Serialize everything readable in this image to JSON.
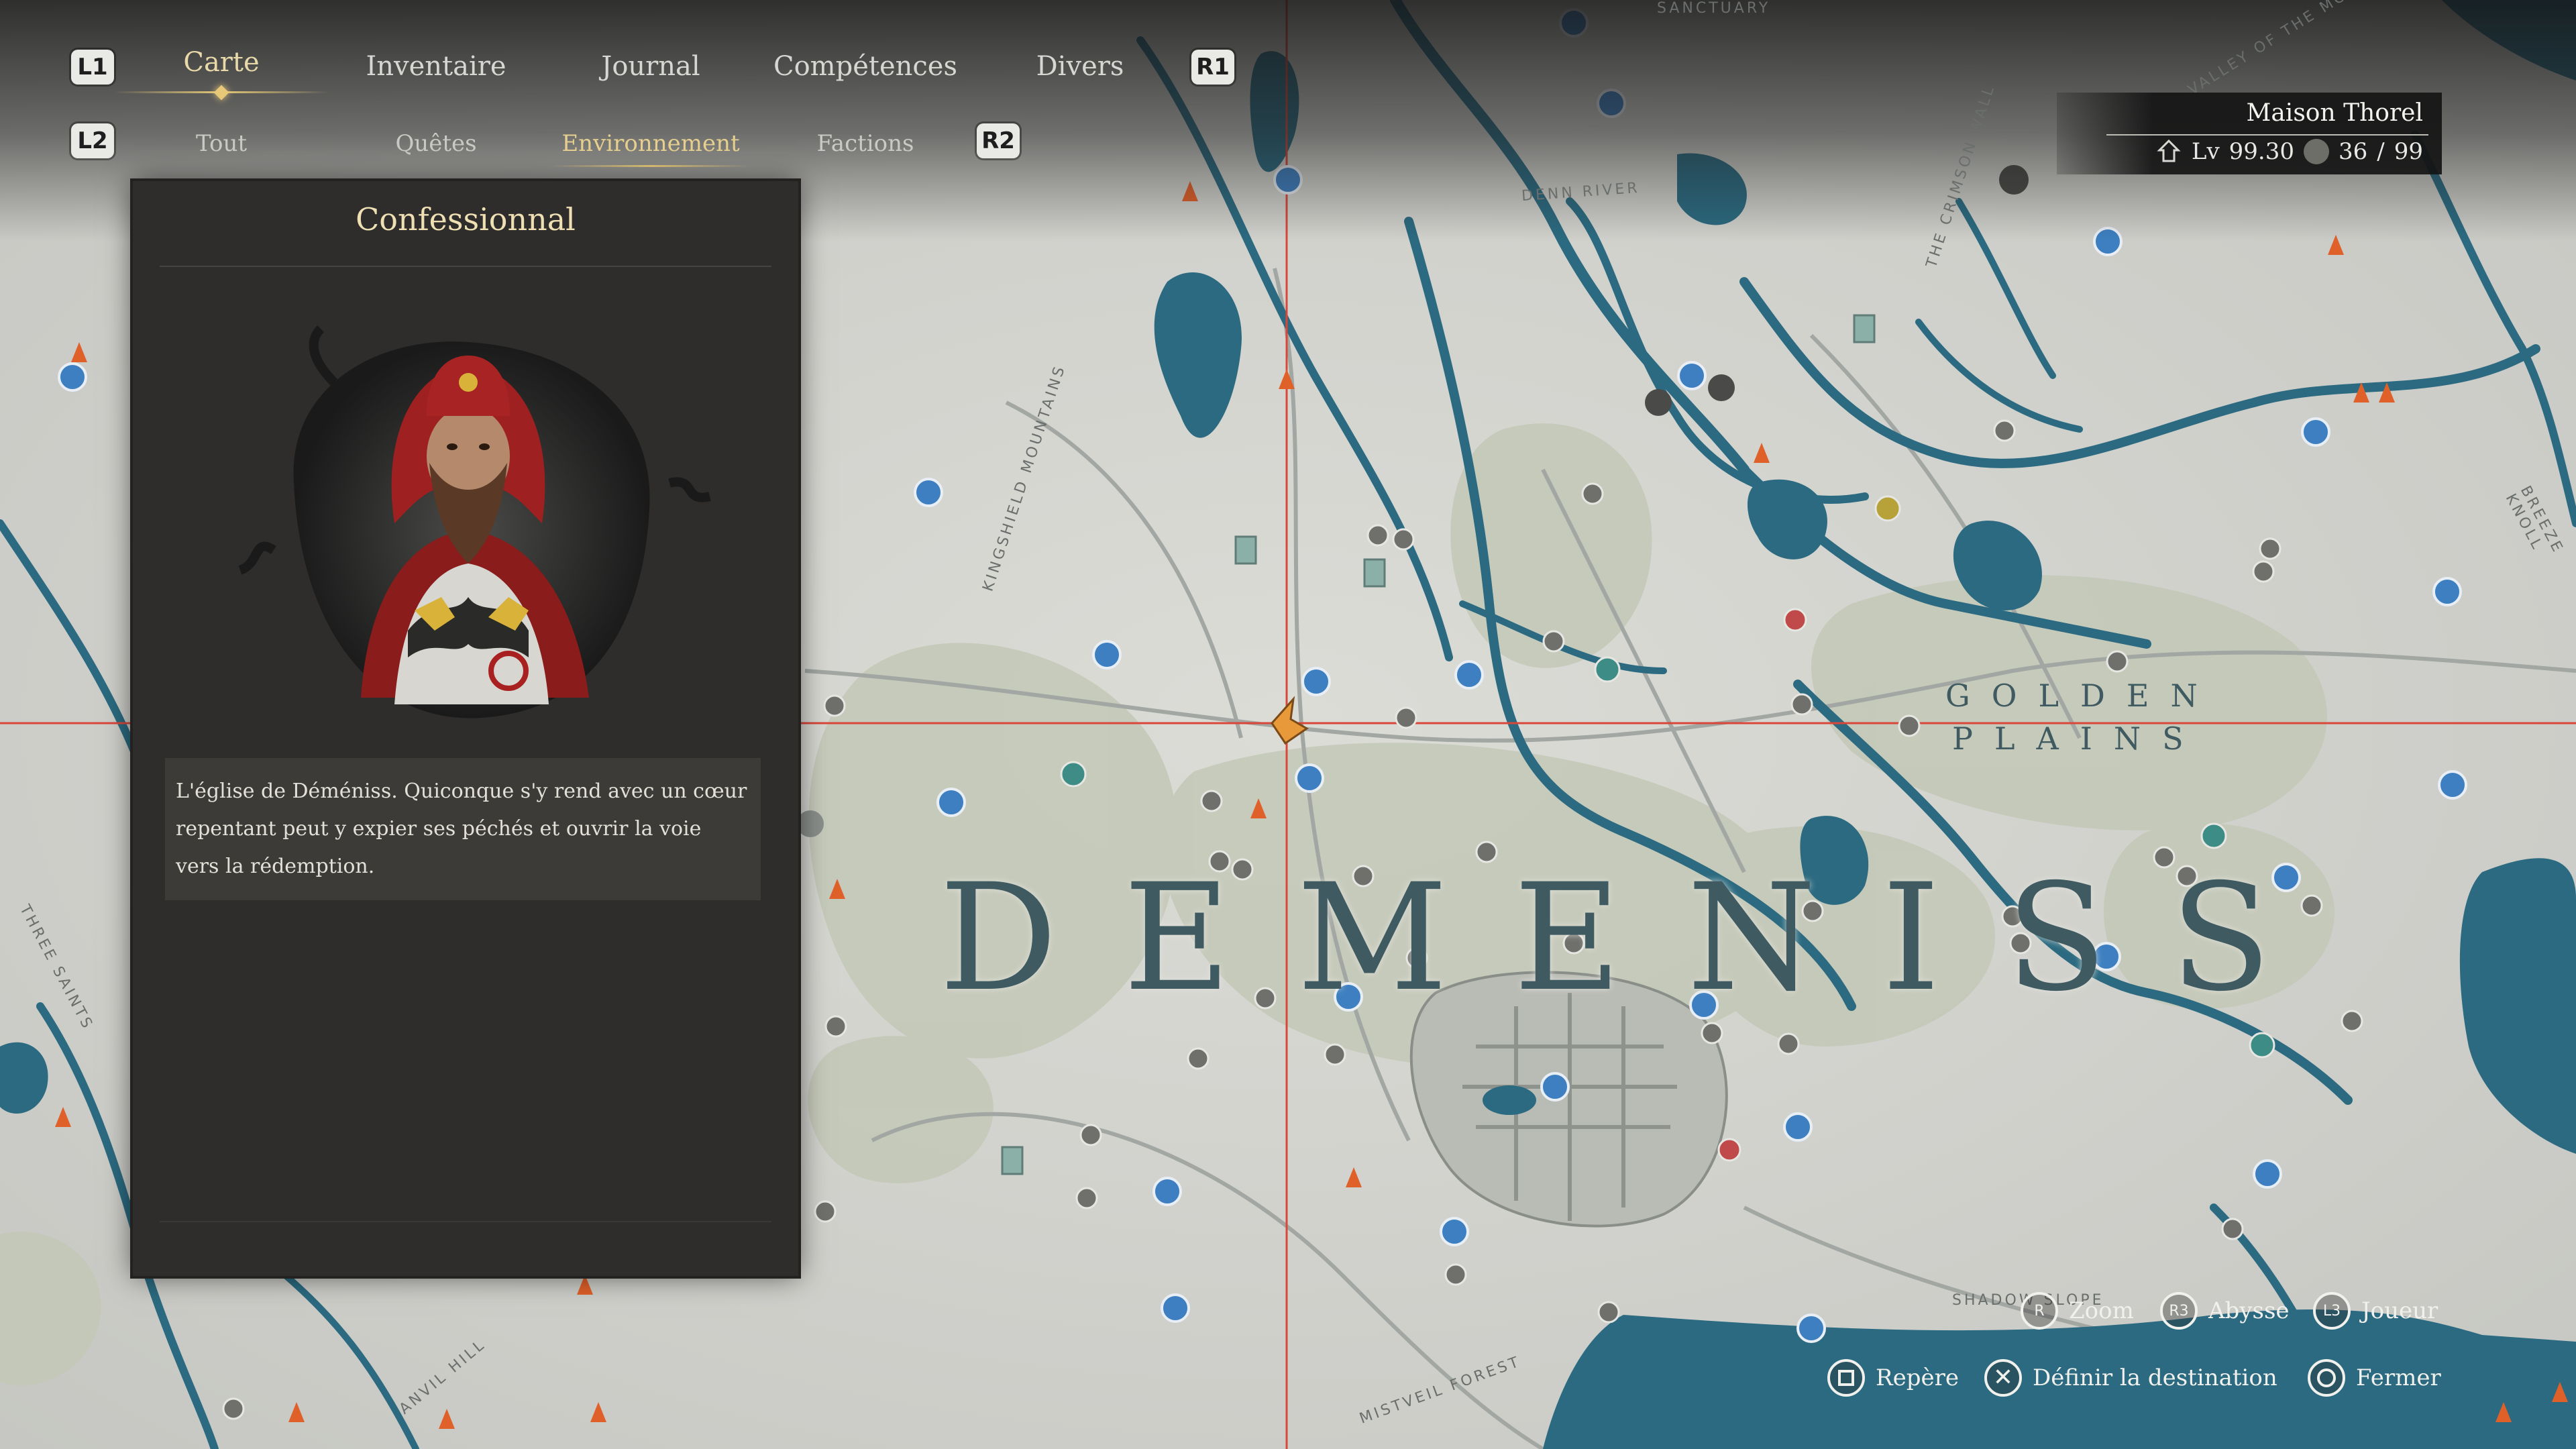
{
  "nav": {
    "tabs": [
      {
        "label": "Carte",
        "active": true
      },
      {
        "label": "Inventaire",
        "active": false
      },
      {
        "label": "Journal",
        "active": false
      },
      {
        "label": "Compétences",
        "active": false
      },
      {
        "label": "Divers",
        "active": false
      }
    ],
    "left_hint": "L1",
    "right_hint": "R1",
    "subtabs": [
      {
        "label": "Tout",
        "active": false
      },
      {
        "label": "Quêtes",
        "active": false
      },
      {
        "label": "Environnement",
        "active": true
      },
      {
        "label": "Factions",
        "active": false
      }
    ],
    "sub_left_hint": "L2",
    "sub_right_hint": "R2"
  },
  "panel": {
    "title": "Confessionnal",
    "description": "L'église de Déméniss. Quiconque s'y rend avec un cœur repentant peut y expier ses péchés et ouvrir la voie vers la rédemption."
  },
  "player": {
    "name": "Maison Thorel",
    "level_label": "Lv",
    "level": "99.30",
    "count_current": "36",
    "count_sep": "/",
    "count_max": "99"
  },
  "map": {
    "region_name": "DEMENISS",
    "subregion": [
      "GOLDEN",
      "PLAINS"
    ],
    "labels": [
      "VALLEY OF THE MOON",
      "DENN RIVER",
      "THE CRIMSON WALL",
      "KINGSHIELD MOUNTAINS",
      "SANCTUARY",
      "SHADOW SLOPE",
      "MISTVEIL FOREST",
      "ANVIL HILL",
      "THREE SAINTS",
      "BREEZE KNOLL"
    ],
    "colors": {
      "water": "#2b6a80",
      "land": "#d4d5d0",
      "town": "#c3c8b6",
      "road": "#9aa09c",
      "crosshair": "#d9473a",
      "waypoint": "#3d7fc0"
    }
  },
  "controls": [
    {
      "btn": "R",
      "label": "Zoom"
    },
    {
      "btn": "R3",
      "label": "Abysse"
    },
    {
      "btn": "L3",
      "label": "Joueur"
    },
    {
      "btn": "square",
      "label": "Repère"
    },
    {
      "btn": "cross",
      "label": "Définir la destination"
    },
    {
      "btn": "circle",
      "label": "Fermer"
    }
  ]
}
